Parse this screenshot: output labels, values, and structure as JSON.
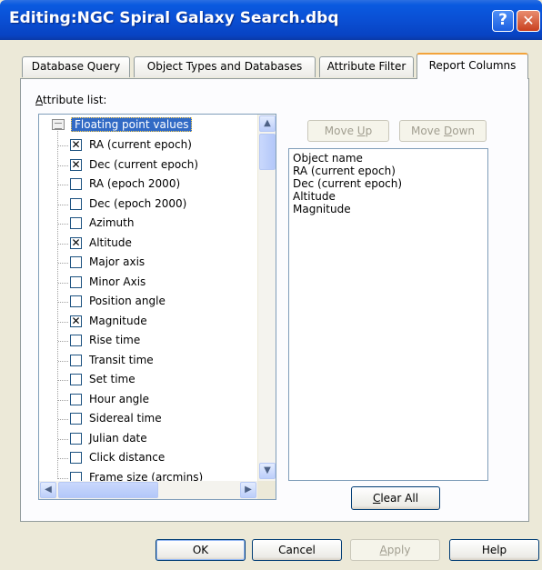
{
  "window": {
    "title": "Editing:NGC Spiral Galaxy Search.dbq",
    "help_glyph": "?",
    "close_glyph": "✕"
  },
  "tabs": [
    {
      "label": "Database Query",
      "active": false
    },
    {
      "label": "Object Types and Databases",
      "active": false
    },
    {
      "label": "Attribute Filter",
      "active": false
    },
    {
      "label": "Report Columns",
      "active": true
    }
  ],
  "attribute_list": {
    "label_accel": "A",
    "label_rest": "ttribute list:",
    "root": "Floating point values",
    "items": [
      {
        "label": "RA (current epoch)",
        "checked": true
      },
      {
        "label": "Dec (current epoch)",
        "checked": true
      },
      {
        "label": "RA (epoch 2000)",
        "checked": false
      },
      {
        "label": "Dec (epoch 2000)",
        "checked": false
      },
      {
        "label": "Azimuth",
        "checked": false
      },
      {
        "label": "Altitude",
        "checked": true
      },
      {
        "label": "Major axis",
        "checked": false
      },
      {
        "label": "Minor Axis",
        "checked": false
      },
      {
        "label": "Position angle",
        "checked": false
      },
      {
        "label": "Magnitude",
        "checked": true
      },
      {
        "label": "Rise time",
        "checked": false
      },
      {
        "label": "Transit time",
        "checked": false
      },
      {
        "label": "Set time",
        "checked": false
      },
      {
        "label": "Hour angle",
        "checked": false
      },
      {
        "label": "Sidereal time",
        "checked": false
      },
      {
        "label": "Julian date",
        "checked": false
      },
      {
        "label": "Click distance",
        "checked": false
      },
      {
        "label": "Frame size (arcmins)",
        "checked": false
      }
    ]
  },
  "move_up": {
    "pre": "Move ",
    "accel": "U",
    "post": "p"
  },
  "move_down": {
    "pre": "Move ",
    "accel": "D",
    "post": "own"
  },
  "report_columns": [
    "Object name",
    "RA (current epoch)",
    "Dec (current epoch)",
    "Altitude",
    "Magnitude"
  ],
  "clear_all": {
    "accel": "C",
    "rest": "lear All"
  },
  "footer": {
    "ok": "OK",
    "cancel": "Cancel",
    "apply_accel": "A",
    "apply_rest": "pply",
    "help": "Help"
  },
  "check_glyph": "✕"
}
